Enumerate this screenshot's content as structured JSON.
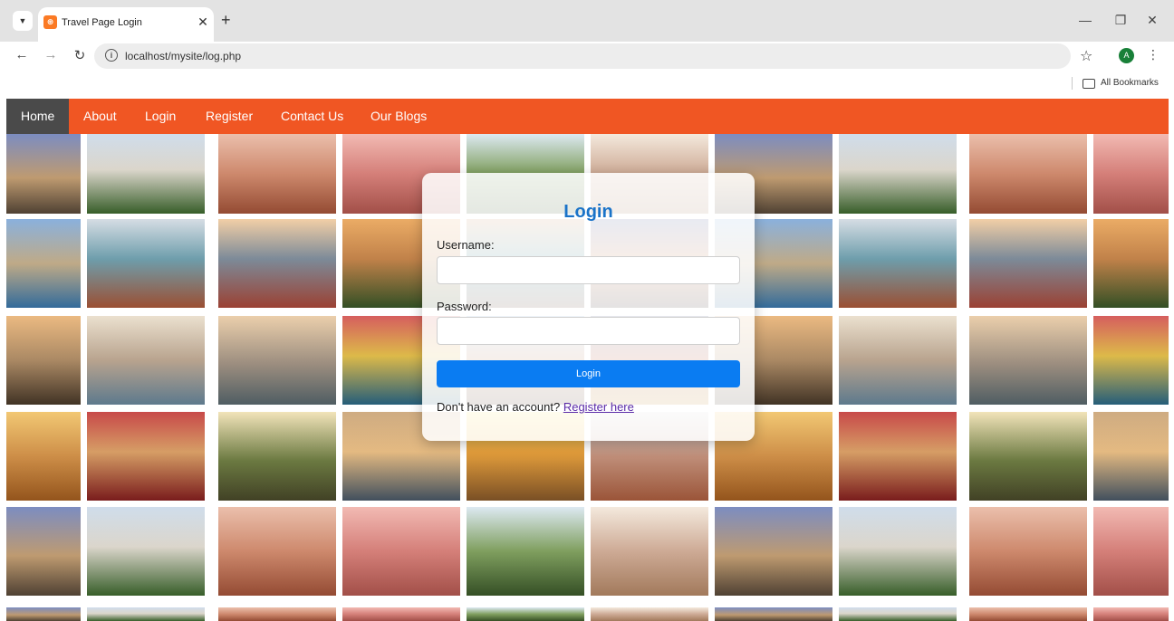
{
  "browser": {
    "tab_title": "Travel Page Login",
    "tab_favicon": "xampp-icon",
    "url": "localhost/mysite/log.php",
    "bookmarks_label": "All Bookmarks",
    "avatar_letter": "A"
  },
  "nav": {
    "items": [
      {
        "label": "Home",
        "active": true
      },
      {
        "label": "About"
      },
      {
        "label": "Login"
      },
      {
        "label": "Register"
      },
      {
        "label": "Contact Us"
      },
      {
        "label": "Our Blogs"
      }
    ],
    "bg_color": "#f05623",
    "active_color": "#4a4a4a"
  },
  "login": {
    "title": "Login",
    "username_label": "Username:",
    "username_value": "",
    "password_label": "Password:",
    "password_value": "",
    "button_label": "Login",
    "register_prompt": "Don't have an account?",
    "register_link": "Register here",
    "title_color": "#1a73c8",
    "button_color": "#0a7cf2"
  },
  "collage_tiles": [
    {
      "scene": "lit palace at dusk"
    },
    {
      "scene": "white marble memorial"
    },
    {
      "scene": "pink sandstone arcade"
    },
    {
      "scene": "pink palace facade"
    },
    {
      "scene": "temple in greenery"
    },
    {
      "scene": "carved stone archway"
    },
    {
      "scene": "mountain river valley"
    },
    {
      "scene": "colorful heritage house"
    },
    {
      "scene": "steel bridge and city"
    },
    {
      "scene": "palm trees at sunset"
    },
    {
      "scene": "painted haveli doors"
    },
    {
      "scene": "temple tower at sunset"
    },
    {
      "scene": "white marble mausoleum"
    },
    {
      "scene": "river ghats"
    },
    {
      "scene": "sea link bridge"
    },
    {
      "scene": "colorful market tassels"
    },
    {
      "scene": "busy bazaar street"
    },
    {
      "scene": "hanging lanterns"
    },
    {
      "scene": "golden desert dunes"
    },
    {
      "scene": "bridal henna hands"
    },
    {
      "scene": "fort window arches"
    },
    {
      "scene": "lake palace at sunset"
    },
    {
      "scene": "golden fort at sunset"
    },
    {
      "scene": "mosque courtyard"
    }
  ]
}
